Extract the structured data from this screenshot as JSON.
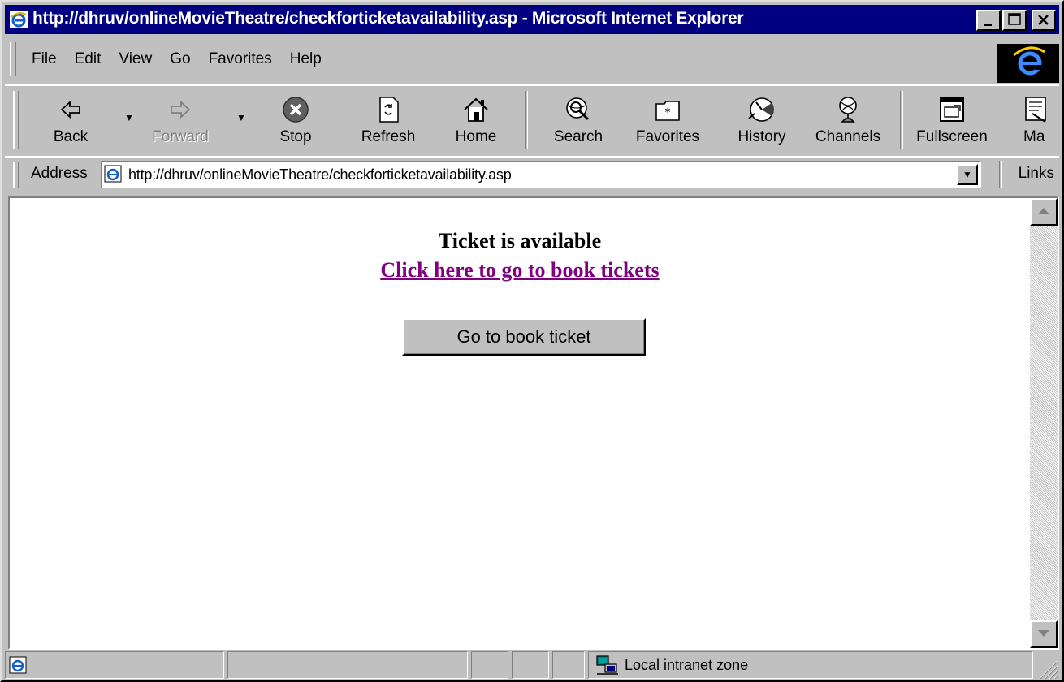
{
  "window": {
    "title": "http://dhruv/onlineMovieTheatre/checkforticketavailability.asp - Microsoft Internet Explorer"
  },
  "menu": {
    "items": [
      "File",
      "Edit",
      "View",
      "Go",
      "Favorites",
      "Help"
    ]
  },
  "toolbar": {
    "buttons": [
      {
        "label": "Back",
        "icon": "back-arrow-icon"
      },
      {
        "label": "Forward",
        "icon": "forward-arrow-icon",
        "disabled": true
      },
      {
        "label": "Stop",
        "icon": "stop-icon"
      },
      {
        "label": "Refresh",
        "icon": "refresh-icon"
      },
      {
        "label": "Home",
        "icon": "home-icon"
      },
      {
        "label": "Search",
        "icon": "search-globe-icon"
      },
      {
        "label": "Favorites",
        "icon": "favorites-folder-icon"
      },
      {
        "label": "History",
        "icon": "history-icon"
      },
      {
        "label": "Channels",
        "icon": "channels-icon"
      },
      {
        "label": "Fullscreen",
        "icon": "fullscreen-icon"
      },
      {
        "label": "Ma",
        "icon": "mail-icon"
      }
    ]
  },
  "address": {
    "label": "Address",
    "url": "http://dhruv/onlineMovieTheatre/checkforticketavailability.asp",
    "links_label": "Links"
  },
  "page": {
    "message": "Ticket is available",
    "link_text": "Click here to go to book tickets",
    "button_label": "Go to book ticket"
  },
  "status": {
    "zone": "Local intranet zone"
  },
  "colors": {
    "titlebar": "#000080",
    "chrome": "#c0c0c0",
    "visited_link": "#800080"
  }
}
